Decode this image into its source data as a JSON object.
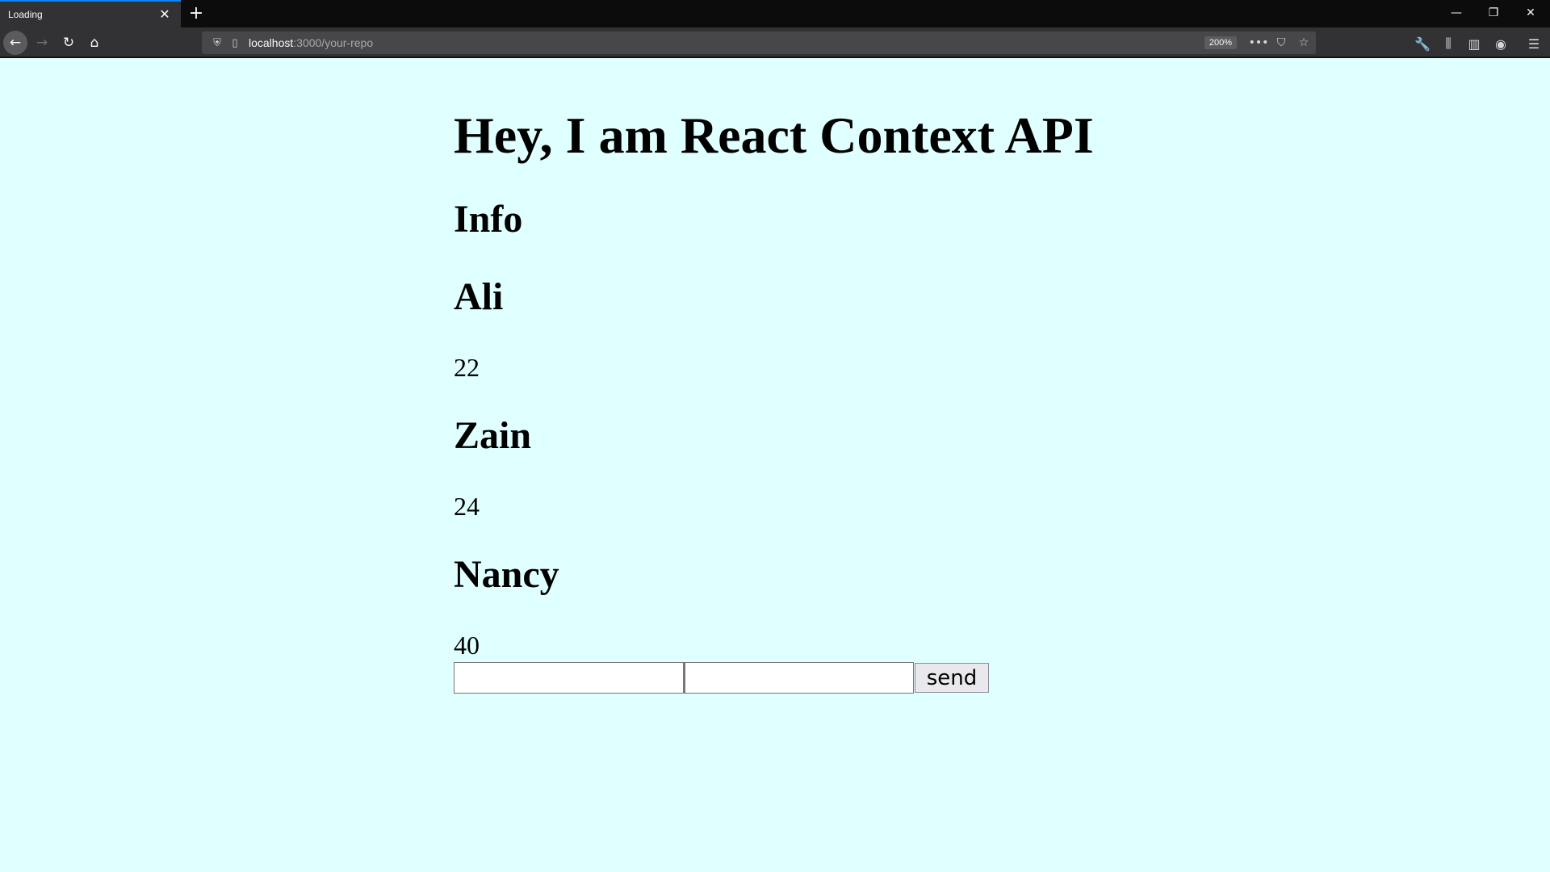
{
  "browser": {
    "tab": {
      "title": "Loading",
      "close_glyph": "✕"
    },
    "new_tab_glyph": "+",
    "window_controls": {
      "minimize": "—",
      "restore": "❐",
      "close": "✕"
    },
    "nav": {
      "back": "←",
      "forward": "→",
      "reload": "↻",
      "home": "⌂"
    },
    "url": {
      "host": "localhost",
      "path": ":3000/your-repo"
    },
    "zoom": "200%",
    "url_actions": {
      "page_actions": "•••",
      "pocket": "⛉",
      "bookmark": "☆"
    },
    "toolbar": {
      "tools": "🔧",
      "library": "⫼",
      "sidebar": "▥",
      "account": "◉",
      "menu": "☰"
    }
  },
  "page": {
    "title": "Hey, I am React Context API",
    "info_heading": "Info",
    "people": [
      {
        "name": "Ali",
        "age": "22"
      },
      {
        "name": "Zain",
        "age": "24"
      },
      {
        "name": "Nancy",
        "age": "40"
      }
    ],
    "form": {
      "name_value": "",
      "age_value": "",
      "send_label": "send"
    }
  }
}
